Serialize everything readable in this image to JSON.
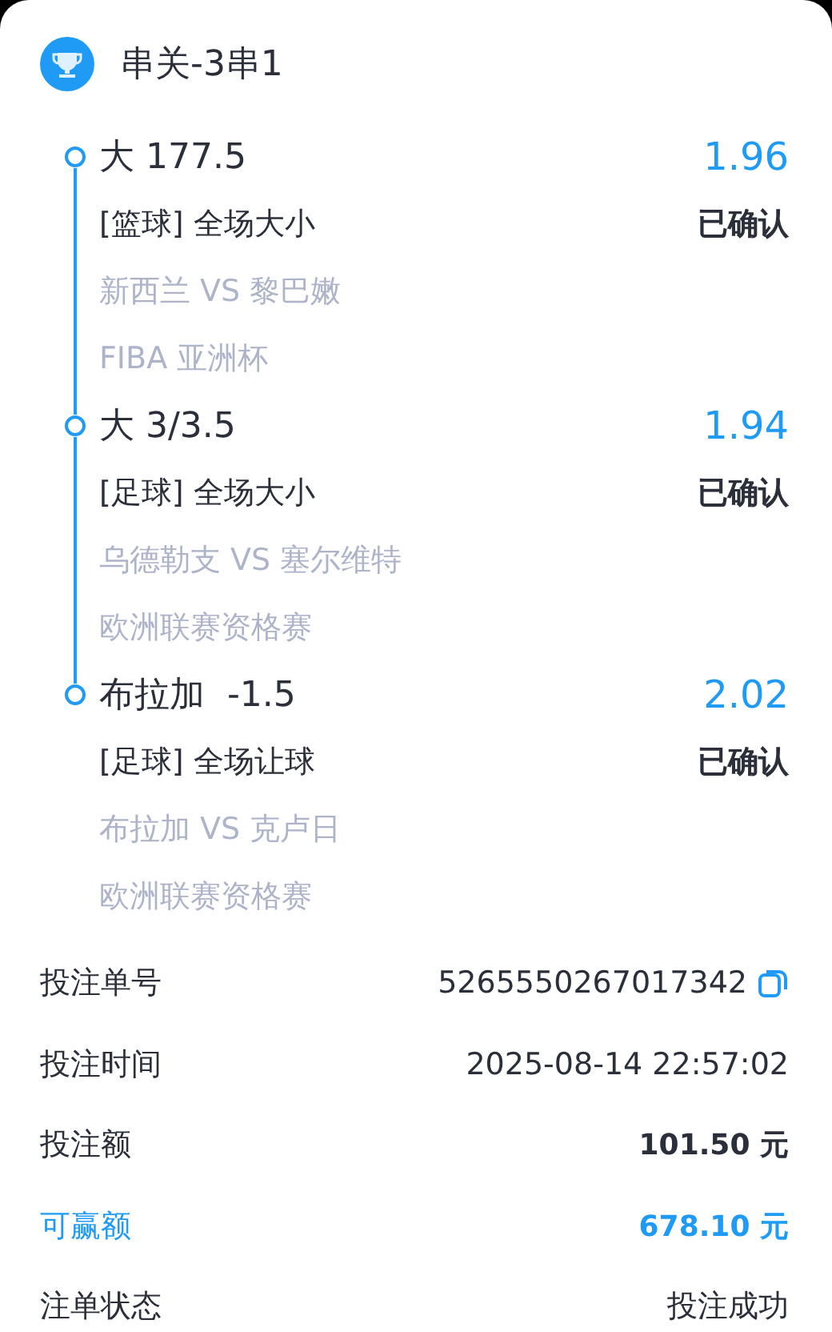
{
  "header": {
    "title": "串关-3串1"
  },
  "legs": [
    {
      "selection": "大 177.5",
      "odds": "1.96",
      "market": "[篮球] 全场大小",
      "status": "已确认",
      "match": "新西兰 VS 黎巴嫩",
      "league": "FIBA 亚洲杯"
    },
    {
      "selection": "大 3/3.5",
      "odds": "1.94",
      "market": "[足球] 全场大小",
      "status": "已确认",
      "match": "乌德勒支 VS 塞尔维特",
      "league": "欧洲联赛资格赛"
    },
    {
      "selection": "布拉加  -1.5",
      "odds": "2.02",
      "market": "[足球] 全场让球",
      "status": "已确认",
      "match": "布拉加 VS 克卢日",
      "league": "欧洲联赛资格赛"
    }
  ],
  "details": [
    {
      "kind": "copyable",
      "label": "投注单号",
      "value": "5265550267017342"
    },
    {
      "kind": "plain",
      "label": "投注时间",
      "value": "2025-08-14 22:57:02"
    },
    {
      "kind": "amount",
      "label": "投注额",
      "value": "101.50 元"
    },
    {
      "kind": "win",
      "label": "可赢额",
      "value": "678.10 元"
    },
    {
      "kind": "plain",
      "label": "注单状态",
      "value": "投注成功"
    }
  ]
}
